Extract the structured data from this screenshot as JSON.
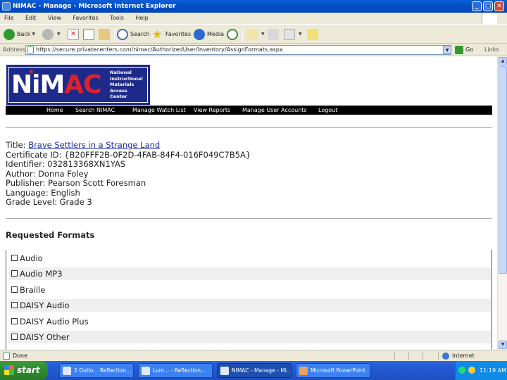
{
  "window": {
    "title": "NIMAC - Manage - Microsoft Internet Explorer"
  },
  "menu": [
    "File",
    "Edit",
    "View",
    "Favorites",
    "Tools",
    "Help"
  ],
  "toolbar": {
    "back": "Back",
    "search": "Search",
    "favorites": "Favorites",
    "media": "Media"
  },
  "address": {
    "label": "Address",
    "url": "https://secure.privatecenters.com/nimac/AuthorizedUser/Inventory/AssignFormats.aspx",
    "go": "Go",
    "links": "Links"
  },
  "logo": {
    "word_white": "NiM",
    "word_red": "AC",
    "subtitle": [
      "National",
      "Instructional",
      "Materials",
      "Access",
      "Center"
    ]
  },
  "site_nav": [
    "Home",
    "Search NIMAC",
    "Manage Watch List",
    "View Reports",
    "Manage User Accounts",
    "Logout"
  ],
  "book": {
    "title_label": "Title:",
    "title_value": "Brave Settlers in a Strange Land",
    "certificate_label": "Certificate ID:",
    "certificate_value": "{B20FFF2B-0F2D-4FAB-84F4-016F049C7B5A}",
    "identifier_label": "Identifier:",
    "identifier_value": "032813368XN1YAS",
    "author_label": "Author:",
    "author_value": "Donna Foley",
    "publisher_label": "Publisher:",
    "publisher_value": "Pearson Scott Foresman",
    "language_label": "Language:",
    "language_value": "English",
    "grade_label": "Grade Level:",
    "grade_value": "Grade 3"
  },
  "requested_formats": {
    "heading": "Requested Formats",
    "items": [
      {
        "label": "Audio",
        "checked": false
      },
      {
        "label": "Audio MP3",
        "checked": false
      },
      {
        "label": "Braille",
        "checked": false
      },
      {
        "label": "DAISY Audio",
        "checked": false
      },
      {
        "label": "DAISY Audio Plus",
        "checked": false
      },
      {
        "label": "DAISY Other",
        "checked": false
      }
    ]
  },
  "status": {
    "text": "Done",
    "zone": "Internet"
  },
  "taskbar": {
    "start": "start",
    "items": [
      "2 Outlo... Reflection...",
      "Lum... - Reflection...",
      "NIMAC - Manage - Mi...",
      "Microsoft PowerPoint ..."
    ],
    "clock": "11:19 AM"
  }
}
